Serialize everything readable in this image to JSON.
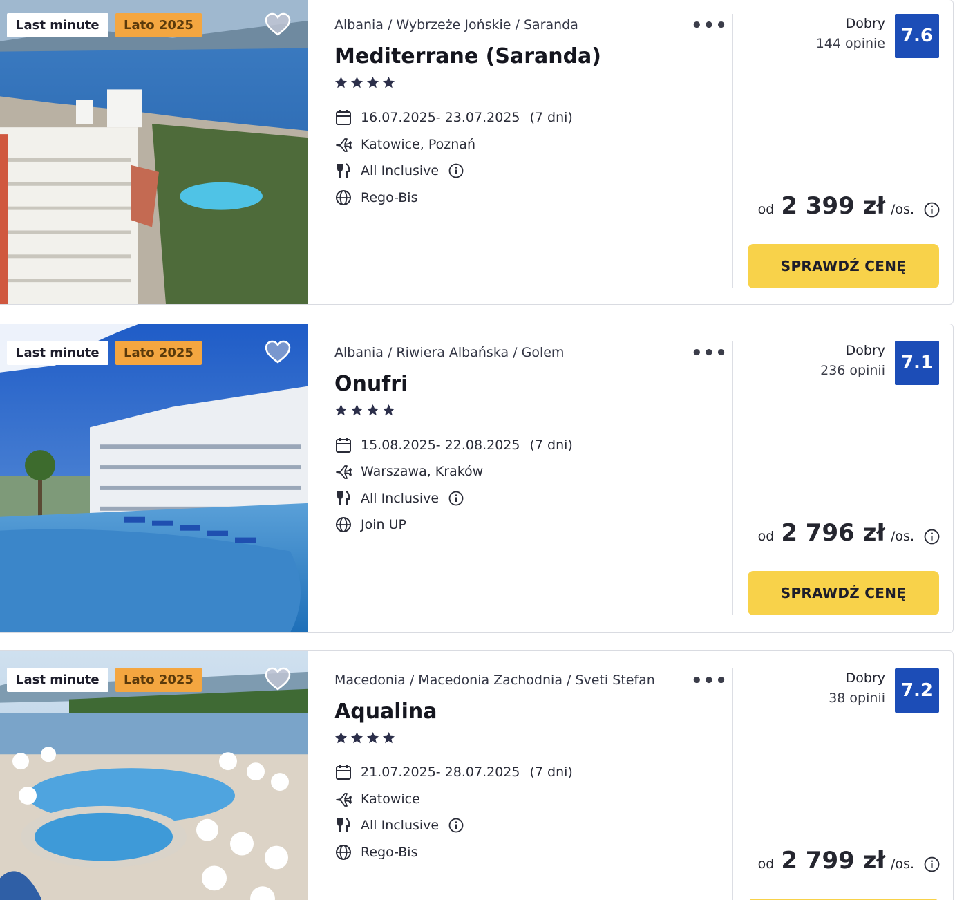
{
  "accent": {
    "badge_season": "#f4a640",
    "score": "#1c4db7",
    "cta": "#f8d24a"
  },
  "offers": [
    {
      "badges": [
        "Last minute",
        "Lato 2025"
      ],
      "breadcrumb": "Albania / Wybrzeże Jońskie / Saranda",
      "name": "Mediterrane (Saranda)",
      "stars": 4,
      "dates": "16.07.2025- 23.07.2025",
      "duration": "(7 dni)",
      "departure": "Katowice, Poznań",
      "board": "All Inclusive",
      "operator": "Rego-Bis",
      "rating_label": "Dobry",
      "reviews": "144 opinie",
      "score": "7.6",
      "price_from": "od",
      "price": "2 399 zł",
      "price_unit": "/os.",
      "cta": "SPRAWDŹ CENĘ"
    },
    {
      "badges": [
        "Last minute",
        "Lato 2025"
      ],
      "breadcrumb": "Albania / Riwiera Albańska / Golem",
      "name": "Onufri",
      "stars": 4,
      "dates": "15.08.2025- 22.08.2025",
      "duration": "(7 dni)",
      "departure": "Warszawa, Kraków",
      "board": "All Inclusive",
      "operator": "Join UP",
      "rating_label": "Dobry",
      "reviews": "236 opinii",
      "score": "7.1",
      "price_from": "od",
      "price": "2 796 zł",
      "price_unit": "/os.",
      "cta": "SPRAWDŹ CENĘ"
    },
    {
      "badges": [
        "Last minute",
        "Lato 2025"
      ],
      "breadcrumb": "Macedonia / Macedonia Zachodnia / Sveti Stefan",
      "name": "Aqualina",
      "stars": 4,
      "dates": "21.07.2025- 28.07.2025",
      "duration": "(7 dni)",
      "departure": "Katowice",
      "board": "All Inclusive",
      "operator": "Rego-Bis",
      "rating_label": "Dobry",
      "reviews": "38 opinii",
      "score": "7.2",
      "price_from": "od",
      "price": "2 799 zł",
      "price_unit": "/os."
    }
  ]
}
